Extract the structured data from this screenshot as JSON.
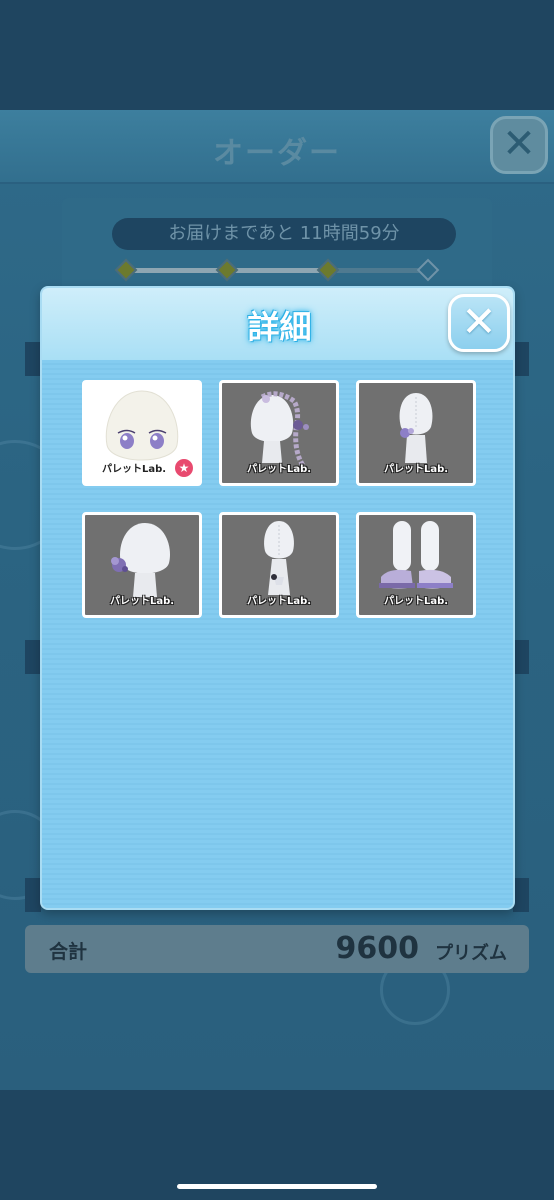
{
  "screen": {
    "title": "オーダー",
    "close_label": "✕",
    "countdown": "お届けまであと 11時間59分",
    "progress": {
      "steps_total": 4,
      "steps_completed": 3
    }
  },
  "total": {
    "label": "合計",
    "value": "9600",
    "unit": "プリズム"
  },
  "modal": {
    "title": "詳細",
    "close_label": "✕",
    "items": [
      {
        "brand": "パレットLab.",
        "kind": "face",
        "featured": true
      },
      {
        "brand": "パレットLab.",
        "kind": "hair-accessory"
      },
      {
        "brand": "パレットLab.",
        "kind": "back-accessory"
      },
      {
        "brand": "パレットLab.",
        "kind": "rose-corsage"
      },
      {
        "brand": "パレットLab.",
        "kind": "dress"
      },
      {
        "brand": "パレットLab.",
        "kind": "shoes"
      }
    ]
  },
  "colors": {
    "modal_bg": "#80c9ee",
    "title_glow": "#33b7ea",
    "badge": "#e84a6f"
  }
}
